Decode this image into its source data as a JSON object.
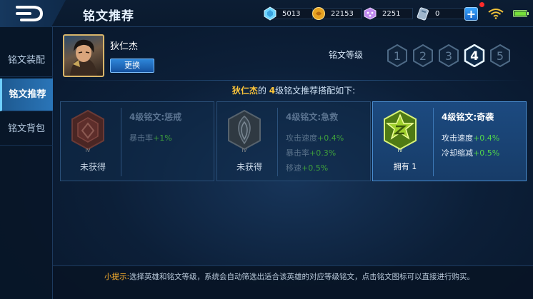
{
  "header": {
    "title": "铭文推荐",
    "resources": [
      {
        "icon": "diamond-icon",
        "value": "5013"
      },
      {
        "icon": "gold-coin-icon",
        "value": "22153"
      },
      {
        "icon": "dice-icon",
        "value": "2251"
      },
      {
        "icon": "voucher-icon",
        "value": "0"
      }
    ],
    "plus_icon": "plus-icon"
  },
  "sidebar": {
    "items": [
      {
        "label": "铭文装配",
        "active": false
      },
      {
        "label": "铭文推荐",
        "active": true
      },
      {
        "label": "铭文背包",
        "active": false
      }
    ]
  },
  "hero": {
    "name": "狄仁杰",
    "change_label": "更换"
  },
  "level_selector": {
    "label": "铭文等级",
    "levels": [
      "1",
      "2",
      "3",
      "4",
      "5"
    ],
    "selected": "4"
  },
  "headline": {
    "hero": "狄仁杰",
    "middle": "的",
    "level": "4",
    "rest": "级铭文推荐搭配如下:"
  },
  "runes": [
    {
      "name": "4级铭文:惩戒",
      "status": "未获得",
      "tier": "IV",
      "color": "#7a2d2a",
      "attrs": [
        {
          "label": "暴击率",
          "value": "+1%"
        }
      ]
    },
    {
      "name": "4级铭文:急救",
      "status": "未获得",
      "tier": "IV",
      "color": "#4a5560",
      "attrs": [
        {
          "label": "攻击速度",
          "value": "+0.4%"
        },
        {
          "label": "暴击率",
          "value": "+0.3%"
        },
        {
          "label": "移速",
          "value": "+0.5%"
        }
      ]
    },
    {
      "name": "4级铭文:奇袭",
      "status_label": "拥有",
      "status_count": "1",
      "tier": "IV",
      "color": "#8fbf2a",
      "attrs": [
        {
          "label": "攻击速度",
          "value": "+0.4%"
        },
        {
          "label": "冷却缩减",
          "value": "+0.5%"
        }
      ]
    }
  ],
  "tip": {
    "label": "小提示:",
    "text": "选择英雄和铭文等级，系统会自动筛选出适合该英雄的对应等级铭文，点击铭文图标可以直接进行购买。"
  }
}
